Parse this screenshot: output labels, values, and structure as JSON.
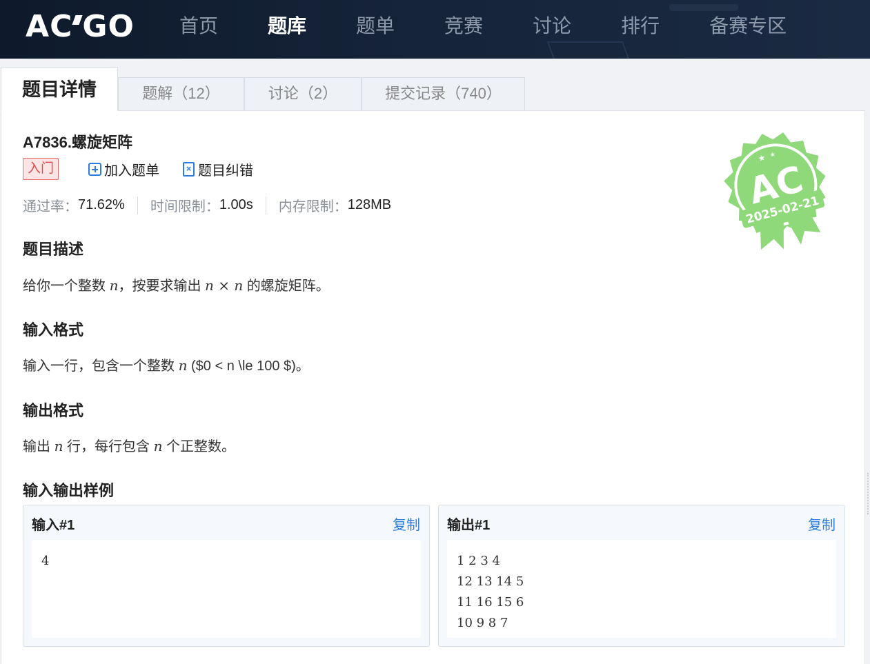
{
  "brand": {
    "logo_left": "A",
    "logo_mid": "C",
    "logo_right": "GO"
  },
  "nav": [
    {
      "label": "首页",
      "active": false
    },
    {
      "label": "题库",
      "active": true
    },
    {
      "label": "题单",
      "active": false
    },
    {
      "label": "竞赛",
      "active": false
    },
    {
      "label": "讨论",
      "active": false
    },
    {
      "label": "排行",
      "active": false
    },
    {
      "label": "备赛专区",
      "active": false
    }
  ],
  "tabs": [
    {
      "label": "题目详情",
      "active": true
    },
    {
      "label": "题解（12）",
      "active": false
    },
    {
      "label": "讨论（2）",
      "active": false
    },
    {
      "label": "提交记录（740）",
      "active": false
    }
  ],
  "problem": {
    "title": "A7836.螺旋矩阵",
    "level": "入门",
    "add_to_list": "加入题单",
    "report_error": "题目纠错",
    "pass_rate_label": "通过率：",
    "pass_rate": "71.62%",
    "time_limit_label": "时间限制：",
    "time_limit": "1.00s",
    "memory_limit_label": "内存限制：",
    "memory_limit": "128MB"
  },
  "badge": {
    "text": "AC",
    "date": "2025-02-21",
    "color": "#8fd97a"
  },
  "sections": {
    "desc_title": "题目描述",
    "desc_a": "给你一个整数 ",
    "desc_n1": "n",
    "desc_b": "，按要求输出 ",
    "desc_expr": "n × n",
    "desc_c": " 的螺旋矩阵。",
    "input_title": "输入格式",
    "input_a": "输入一行，包含一个整数 ",
    "input_n": "n",
    "input_b": " ($0 < n \\le 100 $)。",
    "output_title": "输出格式",
    "output_a": "输出 ",
    "output_n1": "n",
    "output_b": " 行，每行包含 ",
    "output_n2": "n",
    "output_c": " 个正整数。",
    "samples_title": "输入输出样例"
  },
  "samples": {
    "input_label": "输入#1",
    "output_label": "输出#1",
    "copy_label": "复制",
    "input": "4",
    "output": "1 2 3 4\n12 13 14 5\n11 16 15 6\n10 9 8 7"
  }
}
